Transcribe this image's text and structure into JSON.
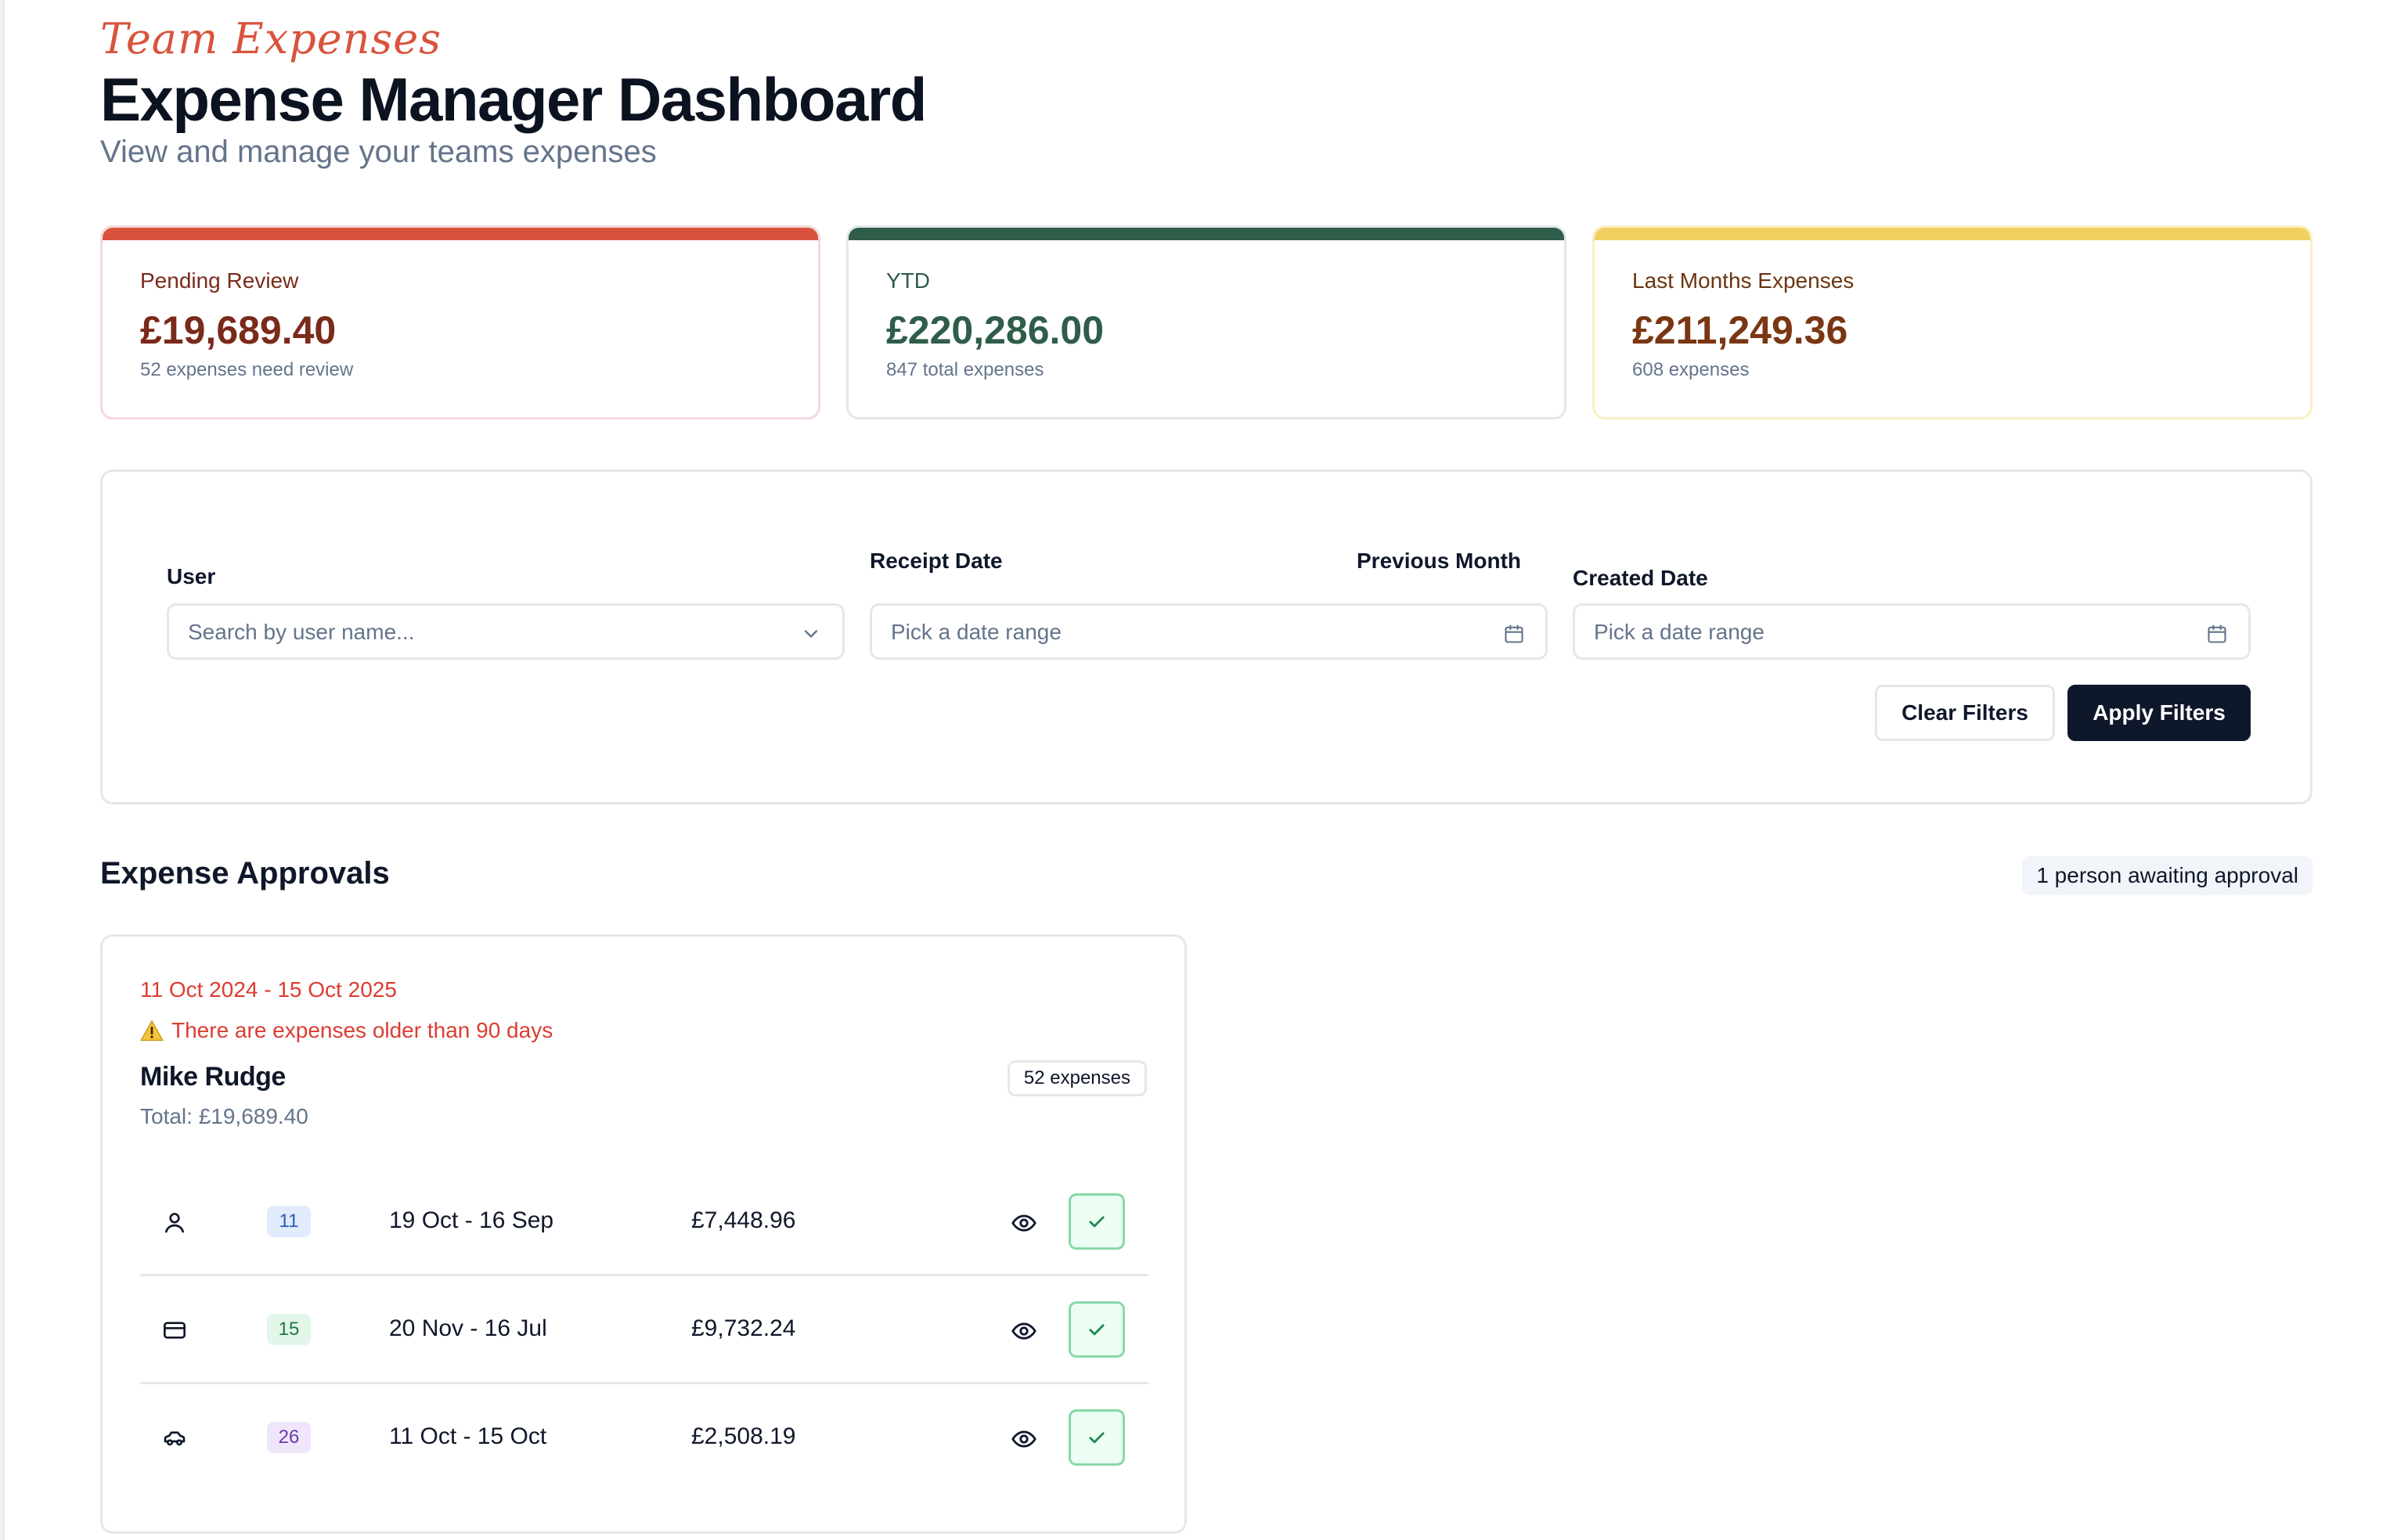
{
  "header": {
    "script_title": "Team Expenses",
    "title": "Expense Manager Dashboard",
    "subtitle": "View and manage your teams expenses"
  },
  "stats": [
    {
      "label": "Pending Review",
      "value": "£19,689.40",
      "note": "52 expenses need review",
      "accent": "#d9533c",
      "label_color": "#7a2a1a",
      "value_color": "#7a2a1a"
    },
    {
      "label": "YTD",
      "value": "£220,286.00",
      "note": "847 total expenses",
      "accent": "#2f5d4a",
      "label_color": "#2f5d4a",
      "value_color": "#2f5d4a"
    },
    {
      "label": "Last Months Expenses",
      "value": "£211,249.36",
      "note": "608 expenses",
      "accent": "#f0d060",
      "label_color": "#6b3512",
      "value_color": "#7a3612"
    }
  ],
  "filters": {
    "user_label": "User",
    "user_placeholder": "Search by user name...",
    "receipt_label": "Receipt Date",
    "receipt_preset": "Previous Month",
    "receipt_placeholder": "Pick a date range",
    "created_label": "Created Date",
    "created_placeholder": "Pick a date range",
    "clear_label": "Clear Filters",
    "apply_label": "Apply Filters"
  },
  "approvals": {
    "title": "Expense Approvals",
    "awaiting": "1 person awaiting approval",
    "card": {
      "range": "11 Oct 2024 - 15 Oct 2025",
      "warning": "There are expenses older than 90 days",
      "person": "Mike Rudge",
      "count": "52 expenses",
      "total": "Total: £19,689.40",
      "rows": [
        {
          "icon": "user-icon",
          "count": "11",
          "dates": "19 Oct - 16 Sep",
          "amount": "£7,448.96",
          "pill_bg": "#e0ebfb",
          "pill_fg": "#2a5cb8"
        },
        {
          "icon": "credit-card-icon",
          "count": "15",
          "dates": "20 Nov - 16 Jul",
          "amount": "£9,732.24",
          "pill_bg": "#e3f6ea",
          "pill_fg": "#1f7a45"
        },
        {
          "icon": "car-icon",
          "count": "26",
          "dates": "11 Oct - 15 Oct",
          "amount": "£2,508.19",
          "pill_bg": "#f0e6fb",
          "pill_fg": "#6b3aa8"
        }
      ]
    }
  },
  "colors": {
    "accent_red": "#dc3c31",
    "primary_dark": "#0f172a",
    "approve_green": "#1f8a50"
  }
}
